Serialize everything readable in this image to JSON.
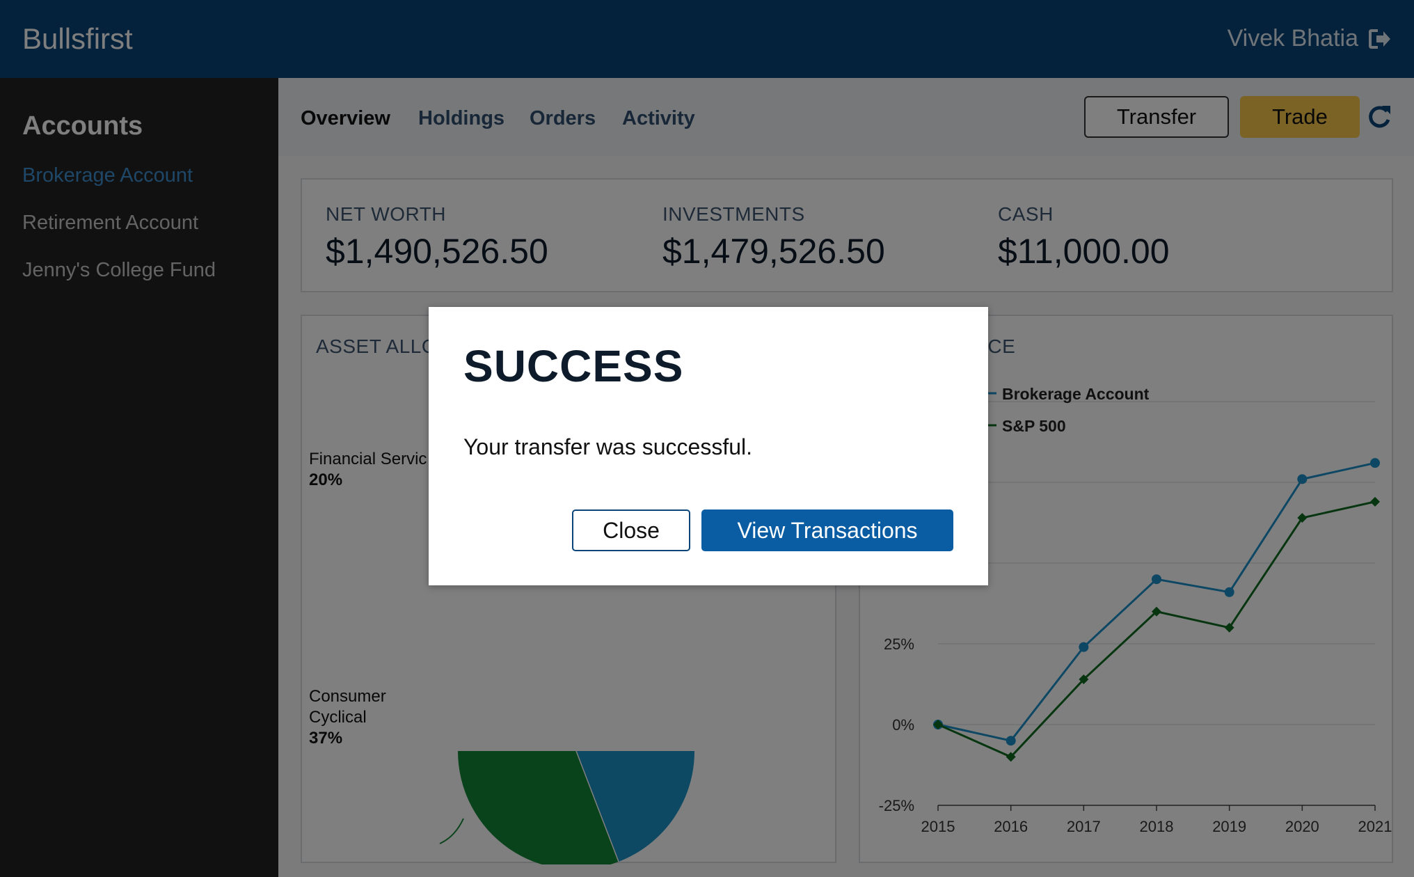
{
  "header": {
    "brand": "Bullsfirst",
    "user_name": "Vivek Bhatia",
    "logout_icon": "logout-icon"
  },
  "sidebar": {
    "title": "Accounts",
    "items": [
      {
        "label": "Brokerage Account",
        "active": true
      },
      {
        "label": "Retirement Account",
        "active": false
      },
      {
        "label": "Jenny's College Fund",
        "active": false
      }
    ]
  },
  "toolbar": {
    "tabs": [
      {
        "label": "Overview",
        "active": true
      },
      {
        "label": "Holdings",
        "active": false
      },
      {
        "label": "Orders",
        "active": false
      },
      {
        "label": "Activity",
        "active": false
      }
    ],
    "transfer_label": "Transfer",
    "trade_label": "Trade",
    "refresh_icon": "refresh-icon"
  },
  "summary": {
    "net_worth_label": "NET WORTH",
    "net_worth_value": "$1,490,526.50",
    "investments_label": "INVESTMENTS",
    "investments_value": "$1,479,526.50",
    "cash_label": "CASH",
    "cash_value": "$11,000.00"
  },
  "asset_panel": {
    "title_visible": "ASSET ALLO",
    "label_fin_name": "Financial Servic",
    "label_fin_pct": "20%",
    "label_cons_line1": "Consumer",
    "label_cons_line2": "Cyclical",
    "label_cons_pct": "37%"
  },
  "perf_panel": {
    "title_visible": "NCE"
  },
  "colors": {
    "header": "#0a4478",
    "accent_gold": "#f6c44a",
    "primary_blue": "#0a5da3",
    "series_blue": "#1b8fc8",
    "series_green": "#0d6b20"
  },
  "chart_data": {
    "type": "line",
    "x": [
      "2015",
      "2016",
      "2017",
      "2018",
      "2019",
      "2020",
      "2021"
    ],
    "series": [
      {
        "name": "Brokerage Account",
        "values": [
          0,
          -5,
          24,
          45,
          41,
          76,
          81
        ]
      },
      {
        "name": "S&P 500",
        "values": [
          0,
          -10,
          14,
          35,
          30,
          64,
          69
        ]
      }
    ],
    "y_ticks": [
      "-25%",
      "0%",
      "25%"
    ],
    "ylim": [
      -25,
      100
    ],
    "legend": "top-left",
    "grid": true
  },
  "modal": {
    "title": "SUCCESS",
    "message": "Your transfer was successful.",
    "close_label": "Close",
    "view_label": "View Transactions"
  }
}
